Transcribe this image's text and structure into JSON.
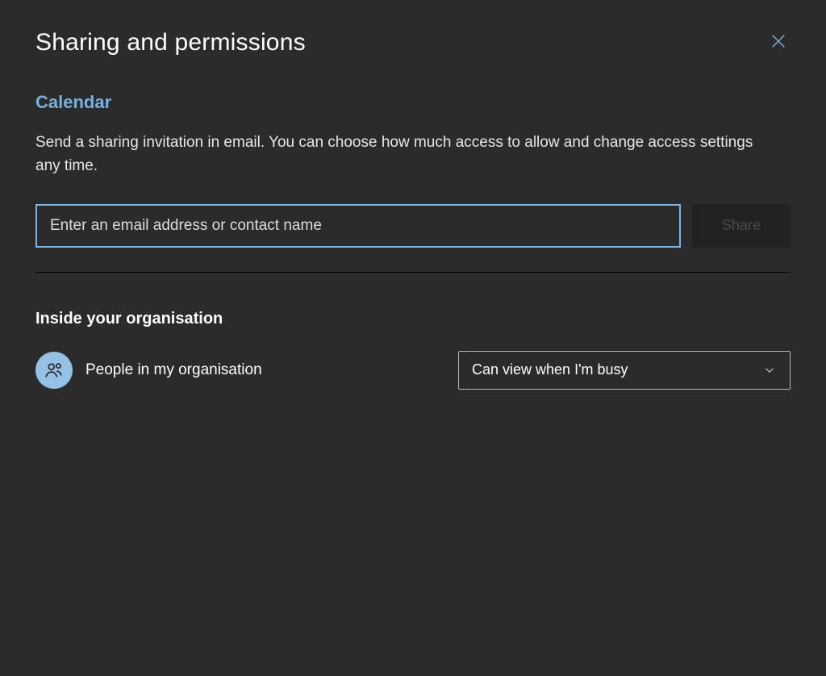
{
  "header": {
    "title": "Sharing and permissions"
  },
  "calendar": {
    "subtitle": "Calendar",
    "description": "Send a sharing invitation in email. You can choose how much access to allow and change access settings any time.",
    "email_input": {
      "placeholder": "Enter an email address or contact name",
      "value": ""
    },
    "share_button_label": "Share"
  },
  "organisation": {
    "heading": "Inside your organisation",
    "row_label": "People in my organisation",
    "select_value": "Can view when I'm busy"
  }
}
